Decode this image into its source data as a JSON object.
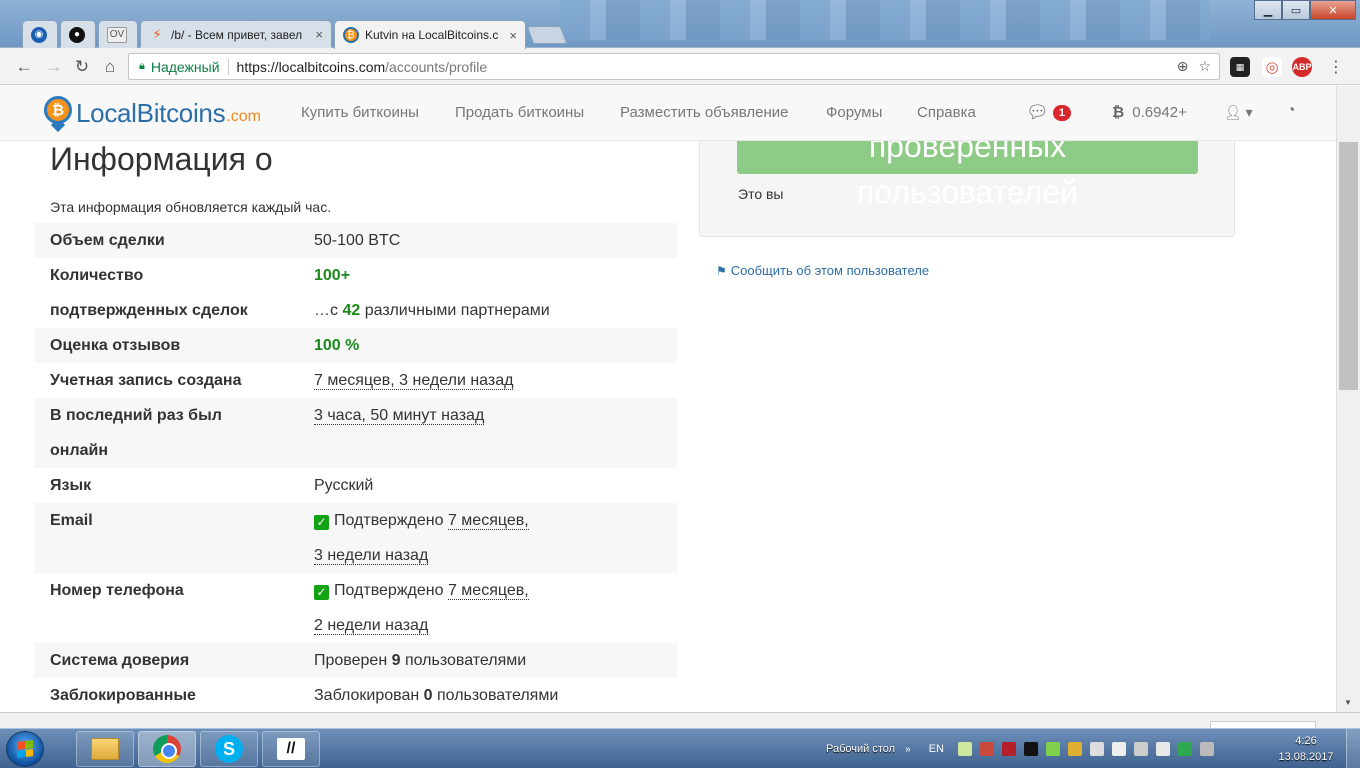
{
  "browser": {
    "tabs": [
      {
        "title": "",
        "icon": "location-pin-icon",
        "color": "#1a5fb4"
      },
      {
        "title": "",
        "icon": "github-icon",
        "color": "#111111"
      },
      {
        "title": "OV",
        "icon": "ov-icon",
        "color": "#555555"
      },
      {
        "title": "/b/ - Всем привет, завел",
        "icon": "lightning-icon",
        "color": "#e8612c"
      },
      {
        "title": "Kutvin на LocalBitcoins.c",
        "icon": "localbitcoins-icon",
        "color": "#2b6ea8"
      }
    ],
    "address": {
      "secure_label": "Надежный",
      "url_host": "https://localbitcoins.com",
      "url_path": "/accounts/profile"
    },
    "extensions": [
      {
        "name": "trello-icon",
        "color": "#222222",
        "label": ""
      },
      {
        "name": "target-icon",
        "color": "#e24c3b",
        "label": ""
      },
      {
        "name": "adblock-icon",
        "color": "#d42a2a",
        "label": "ABP"
      }
    ]
  },
  "site": {
    "brand": "LocalBitcoins",
    "brand_domain": ".com",
    "nav": [
      "Купить биткоины",
      "Продать биткоины",
      "Разместить объявление",
      "Форумы",
      "Справка"
    ],
    "messages_count": "1",
    "balance": "0.6942+"
  },
  "profile": {
    "heading": "Информация о",
    "subtext": "Эта информация обновляется каждый час.",
    "rows": {
      "volume": {
        "key": "Объем сделки",
        "value": "50-100 BTC"
      },
      "trades": {
        "key1": "Количество",
        "key2": "подтвержденных сделок",
        "value": "100+",
        "partners_prefix": "…с ",
        "partners_count": "42",
        "partners_suffix": " различными партнерами"
      },
      "feedback": {
        "key": "Оценка отзывов",
        "value": "100 %"
      },
      "created": {
        "key": "Учетная запись создана",
        "value": "7 месяцев, 3 недели назад"
      },
      "last_seen": {
        "key1": "В последний раз был",
        "key2": "онлайн",
        "value": "3 часа, 50 минут назад"
      },
      "language": {
        "key": "Язык",
        "value": "Русский"
      },
      "email": {
        "key": "Email",
        "status": "Подтверждено",
        "time1": "7 месяцев,",
        "time2": "3 недели назад"
      },
      "phone": {
        "key": "Номер телефона",
        "status": "Подтверждено",
        "time1": "7 месяцев,",
        "time2": "2 недели назад"
      },
      "trust": {
        "key": "Система доверия",
        "prefix": "Проверен ",
        "count": "9",
        "suffix": " пользователями"
      },
      "blocked": {
        "key": "Заблокированные",
        "prefix": "Заблокирован ",
        "count": "0",
        "suffix": " пользователями"
      }
    },
    "panel": {
      "button_line1": "проверенных",
      "button_line2": "пользователей",
      "this_is_you": "Это вы"
    },
    "report_link": "Сообщить об этом пользователе"
  },
  "taskbar": {
    "desktop_label": "Рабочий стол",
    "lang": "EN",
    "time": "4:26",
    "date": "13.08.2017"
  }
}
